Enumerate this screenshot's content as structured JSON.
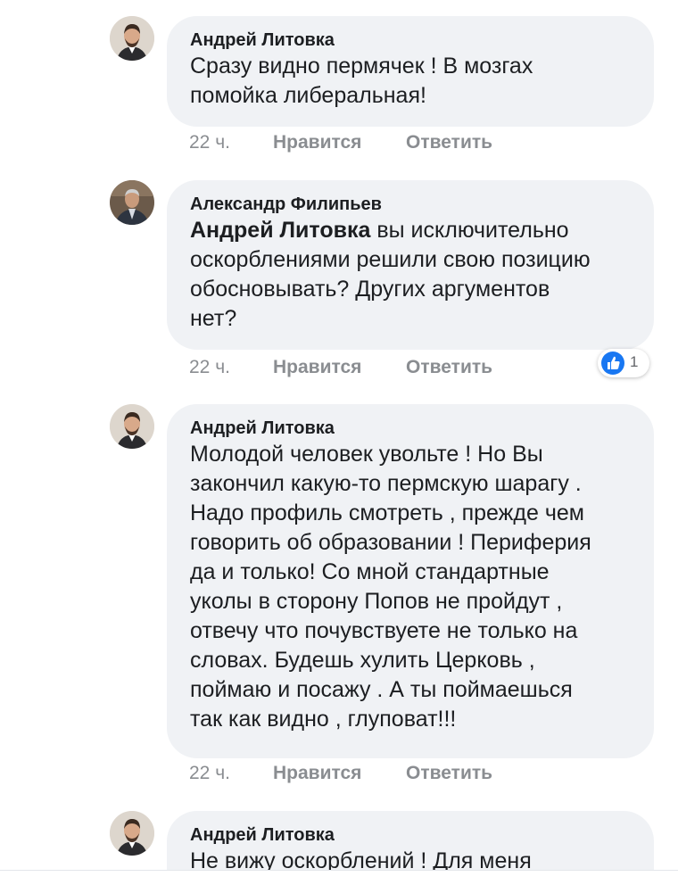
{
  "comments": [
    {
      "author": "Андрей Литовка",
      "text": "Сразу видно пермячек  ! В мозгах\nпомойка либеральная!",
      "time": "22 ч.",
      "like": "Нравится",
      "reply": "Ответить"
    },
    {
      "author": "Александр Филипьев",
      "mention": "Андрей Литовка",
      "text": " вы исключительно\nоскорблениями решили свою позицию\nобосновывать? Других аргументов\nнет?",
      "time": "22 ч.",
      "like": "Нравится",
      "reply": "Ответить",
      "reaction_count": "1"
    },
    {
      "author": "Андрей Литовка",
      "text": "Молодой человек увольте ! Но Вы\nзакончил какую-то пермскую шарагу .\nНадо профиль смотреть , прежде чем\nговорить об образовании !  Периферия\nда и только! Со мной стандартные\nуколы в сторону Попов не пройдут ,\nотвечу что почувствуете не только на\nсловах. Будешь хулить Церковь ,\nпоймаю и посажу . А ты поймаешься\nтак как видно , глуповат!!!",
      "time": "22 ч.",
      "like": "Нравится",
      "reply": "Ответить"
    },
    {
      "author": "Андрей Литовка",
      "text": "Не вижу  оскорблений ! Для меня"
    }
  ],
  "colors": {
    "bubble": "#f0f2f5",
    "text": "#1c1e21",
    "meta": "#8a8d91",
    "like_blue": "#1877f2"
  }
}
